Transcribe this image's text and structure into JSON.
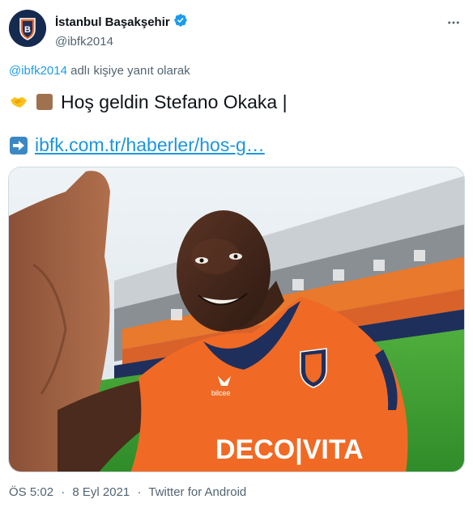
{
  "tweet": {
    "author_name": "İstanbul Başakşehir",
    "author_handle": "@ibfk2014",
    "reply_mention": "@ibfk2014",
    "reply_suffix": "adlı kişiye yanıt olarak",
    "text_line": "Hoş geldin Stefano Okaka |",
    "link_text": "ibfk.com.tr/haberler/hos-g…",
    "time": "ÖS 5:02",
    "separator": "·",
    "date": "8 Eyl 2021",
    "source": "Twitter for Android",
    "media_jersey_brand": "DECO|VITA",
    "media_jersey_maker": "bilcee"
  },
  "icons": {
    "verified": "verified-badge-icon",
    "more": "more-horizontal-icon",
    "handshake": "handshake-emoji-icon",
    "skin_tone": "brown-square-emoji-icon",
    "arrow": "right-arrow-emoji-icon"
  },
  "colors": {
    "accent": "#1d9bf0",
    "link": "#1b95e0",
    "secondary_text": "#536471",
    "jersey_orange": "#f06a25",
    "jersey_navy": "#1f2f5c"
  }
}
